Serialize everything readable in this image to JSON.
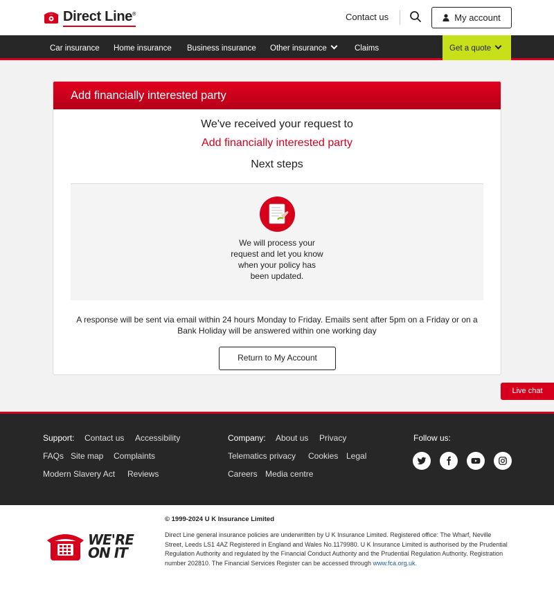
{
  "header": {
    "brand": "Direct Line",
    "contact_label": "Contact us",
    "account_label": "My account"
  },
  "nav": {
    "items": [
      "Car insurance",
      "Home insurance",
      "Business insurance",
      "Other insurance",
      "Claims"
    ],
    "quote_label": "Get a quote"
  },
  "card": {
    "title": "Add financially interested party",
    "received_line": "We've received your request to",
    "request_name": "Add financially interested party",
    "next_steps": "Next steps",
    "step_text": "We will process your request and let you know when your policy has been updated.",
    "response_text": "A response will be sent via email within 24 hours Monday to Friday. Emails sent after 5pm on a Friday or on a Bank Holiday will be answered within one working day",
    "return_label": "Return to My Account"
  },
  "live_chat": "Live chat",
  "footer": {
    "support_label": "Support:",
    "support_links": [
      "Contact us",
      "Accessibility",
      "FAQs",
      "Site map",
      "Complaints",
      "Modern Slavery Act",
      "Reviews"
    ],
    "company_label": "Company:",
    "company_links": [
      "About us",
      "Privacy",
      "Telematics privacy",
      "Cookies",
      "Legal",
      "Careers",
      "Media centre"
    ],
    "follow_label": "Follow us:",
    "social_icons": [
      "twitter-icon",
      "facebook-icon",
      "youtube-icon",
      "instagram-icon"
    ]
  },
  "legal": {
    "slogan": "WE'RE ON IT",
    "copyright": "© 1999-2024 U K Insurance Limited",
    "text": "Direct Line general insurance policies are underwritten by U K Insurance Limited. Registered office: The Wharf, Neville Street, Leeds LS1 4AZ Registered in England and Wales No.1179980. U K Insurance Limited is authorised by the Prudential Regulation Authority and regulated by the Financial Conduct Authority and the Prudential Regulation Authority. Registration number 202810. The Financial Services Register can be accessed through",
    "fca_link": "www.fca.org.uk."
  },
  "colors": {
    "brand_red": "#d6001c",
    "dark": "#272727",
    "quote_green": "#c7e01a"
  }
}
